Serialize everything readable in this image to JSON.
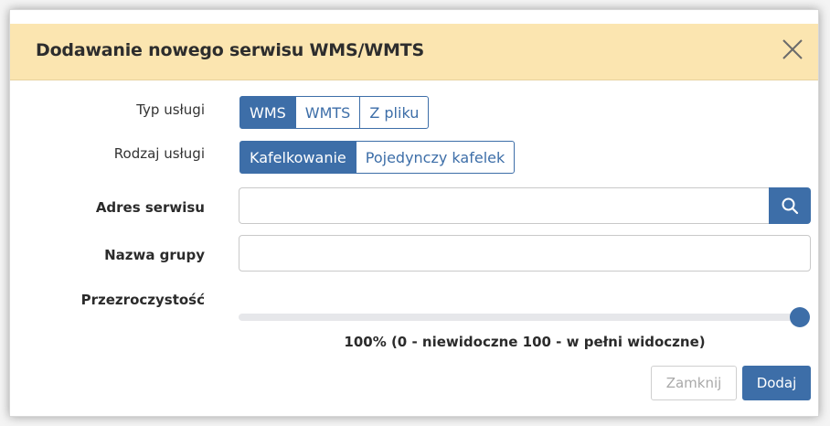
{
  "dialog": {
    "title": "Dodawanie nowego serwisu WMS/WMTS",
    "close_icon": "close-icon"
  },
  "service_type": {
    "label": "Typ usługi",
    "options": [
      "WMS",
      "WMTS",
      "Z pliku"
    ],
    "selected": "WMS"
  },
  "service_kind": {
    "label": "Rodzaj usługi",
    "options": [
      "Kafelkowanie",
      "Pojedynczy kafelek"
    ],
    "selected": "Kafelkowanie"
  },
  "service_address": {
    "label": "Adres serwisu",
    "value": "",
    "placeholder": "",
    "search_icon": "search-icon"
  },
  "group_name": {
    "label": "Nazwa grupy",
    "value": "",
    "placeholder": ""
  },
  "opacity": {
    "label": "Przezroczystość",
    "value": 100,
    "description": "100% (0 - niewidoczne 100 - w pełni widoczne)"
  },
  "footer": {
    "close_label": "Zamknij",
    "add_label": "Dodaj"
  },
  "colors": {
    "header_bg": "#fbe5b0",
    "accent": "#3d6ea8"
  }
}
